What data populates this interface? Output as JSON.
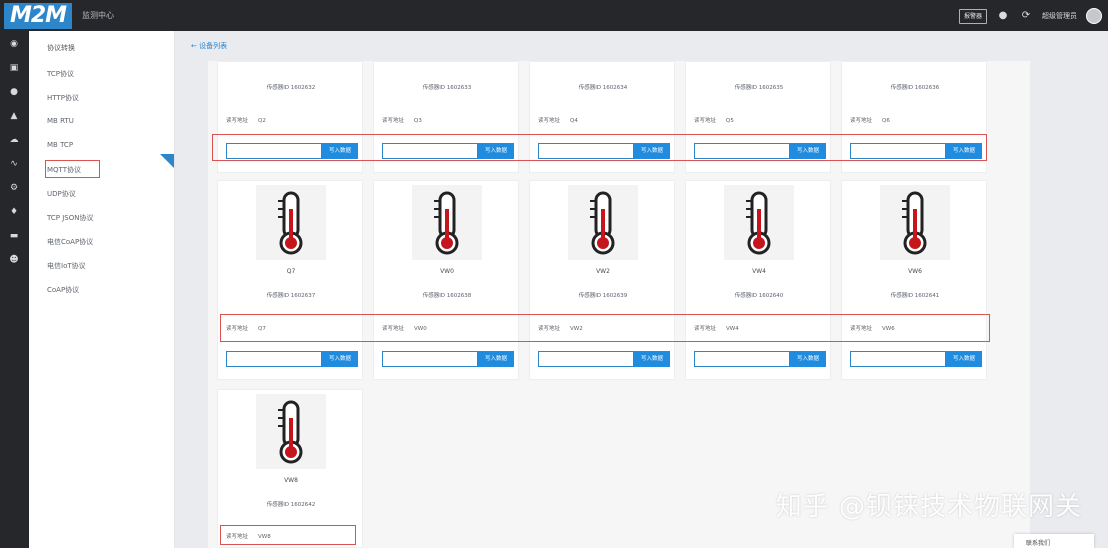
{
  "app": {
    "logo": "M2M",
    "title": "监测中心"
  },
  "topbar": {
    "button_label": "报警器",
    "user_name": "超级管理员"
  },
  "rail": {
    "icons": [
      "dashboard-icon",
      "device-icon",
      "location-icon",
      "alarm-icon",
      "cloud-icon",
      "chart-icon",
      "settings-icon",
      "water-icon",
      "card-icon",
      "user-icon"
    ]
  },
  "submenu": {
    "title": "协议转换",
    "items": [
      "TCP协议",
      "HTTP协议",
      "MB RTU",
      "MB TCP",
      "MQTT协议",
      "UDP协议",
      "TCP JSON协议",
      "电信CoAP协议",
      "电信IoT协议",
      "CoAP协议"
    ],
    "active": "MQTT协议"
  },
  "breadcrumb": "设备列表",
  "cards": {
    "row1": [
      {
        "id_label": "传感器ID",
        "id": "1602632",
        "row_label": "读写地址",
        "row_value": "Q2"
      },
      {
        "id_label": "传感器ID",
        "id": "1602633",
        "row_label": "读写地址",
        "row_value": "Q3"
      },
      {
        "id_label": "传感器ID",
        "id": "1602634",
        "row_label": "读写地址",
        "row_value": "Q4"
      },
      {
        "id_label": "传感器ID",
        "id": "1602635",
        "row_label": "读写地址",
        "row_value": "Q5"
      },
      {
        "id_label": "传感器ID",
        "id": "1602636",
        "row_label": "读写地址",
        "row_value": "Q6"
      }
    ],
    "row2": [
      {
        "name": "Q7",
        "id_label": "传感器ID",
        "id": "1602637",
        "row_label": "读写地址",
        "row_value": "Q7"
      },
      {
        "name": "VW0",
        "id_label": "传感器ID",
        "id": "1602638",
        "row_label": "读写地址",
        "row_value": "VW0"
      },
      {
        "name": "VW2",
        "id_label": "传感器ID",
        "id": "1602639",
        "row_label": "读写地址",
        "row_value": "VW2"
      },
      {
        "name": "VW4",
        "id_label": "传感器ID",
        "id": "1602640",
        "row_label": "读写地址",
        "row_value": "VW4"
      },
      {
        "name": "VW6",
        "id_label": "传感器ID",
        "id": "1602641",
        "row_label": "读写地址",
        "row_value": "VW6"
      }
    ],
    "row3": [
      {
        "name": "VW8",
        "id_label": "传感器ID",
        "id": "1602642",
        "row_label": "读写地址",
        "row_value": "VW8"
      }
    ],
    "button_label": "写入数据"
  },
  "watermark": "知乎 @钡铼技术物联网关",
  "corner_popup": "联系我们"
}
